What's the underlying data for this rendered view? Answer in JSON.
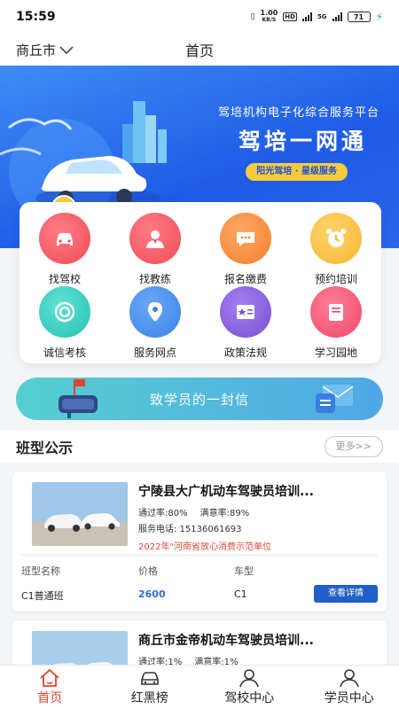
{
  "status_bar": {
    "time": "15:59",
    "net_speed_top": "1.00",
    "net_speed_bottom": "KB/S",
    "hd": "HD",
    "net_type": "4G",
    "net_type2": "5G",
    "battery": "71"
  },
  "header": {
    "city": "商丘市",
    "title": "首页"
  },
  "banner": {
    "subtitle": "驾培机构电子化综合服务平台",
    "title": "驾培一网通",
    "tagline": "阳光驾培 · 星级服务"
  },
  "menu": [
    {
      "label": "找驾校",
      "icon": "car-icon",
      "color": "#ef4b56"
    },
    {
      "label": "找教练",
      "icon": "coach-icon",
      "color": "#ef4b56"
    },
    {
      "label": "报名缴费",
      "icon": "chat-icon",
      "color": "#f5812d"
    },
    {
      "label": "预约培训",
      "icon": "alarm-clock-icon",
      "color": "#f7b731"
    },
    {
      "label": "诚信考核",
      "icon": "target-icon",
      "color": "#26c3b4"
    },
    {
      "label": "服务网点",
      "icon": "location-pin-icon",
      "color": "#3a83e8"
    },
    {
      "label": "政策法规",
      "icon": "newspaper-icon",
      "color": "#7b4fd6"
    },
    {
      "label": "学习园地",
      "icon": "book-icon",
      "color": "#ef4b6a"
    }
  ],
  "letter_banner": {
    "text": "致学员的一封信"
  },
  "section": {
    "title": "班型公示",
    "more": "更多>>"
  },
  "columns": {
    "class_name": "班型名称",
    "price": "价格",
    "vehicle": "车型"
  },
  "schools": [
    {
      "name": "宁陵县大广机动车驾驶员培训...",
      "pass_rate": "通过率:80%",
      "satisfaction": "满意率:89%",
      "phone": "服务电话: 15136061693",
      "honor": "2022年\"河南省放心消费示范单位",
      "class_name": "C1普通班",
      "price": "2600",
      "vehicle": "C1",
      "detail": "查看详情"
    },
    {
      "name": "商丘市金帝机动车驾驶员培训...",
      "pass_rate": "通过率:1%",
      "satisfaction": "满意率:1%"
    }
  ],
  "bottom_nav": [
    {
      "label": "首页",
      "icon": "home-icon",
      "active": true
    },
    {
      "label": "红黑榜",
      "icon": "car-front-icon",
      "active": false
    },
    {
      "label": "驾校中心",
      "icon": "user-icon",
      "active": false
    },
    {
      "label": "学员中心",
      "icon": "user-icon",
      "active": false
    }
  ],
  "colors": {
    "accent": "#1f5fc7",
    "active_nav": "#e0442f",
    "banner": "#2a66ea",
    "tag": "#f7cb3e",
    "honor_text": "#e04a3a"
  }
}
